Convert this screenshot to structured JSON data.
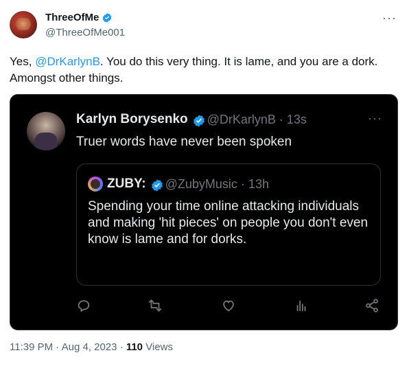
{
  "author": {
    "display_name": "ThreeOfMe",
    "handle": "@ThreeOfMe001"
  },
  "tweet": {
    "text_before": "Yes, ",
    "mention": "@DrKarlynB",
    "text_after": ". You do this very thing. It is lame, and you are a dork. Amongst other things."
  },
  "embedded": {
    "display_name": "Karlyn Borysenko",
    "handle_time": "@DrKarlynB · 13s",
    "text": "Truer words have never been spoken",
    "quoted": {
      "display_name": "ZUBY:",
      "handle_time": "@ZubyMusic · 13h",
      "text": "Spending your time online attacking individuals and making 'hit pieces' on people you don't even know is lame and for dorks."
    },
    "actions": [
      "reply-icon",
      "retweet-icon",
      "like-icon",
      "views-icon",
      "share-icon"
    ]
  },
  "meta": {
    "timestamp": "11:39 PM · Aug 4, 2023 · ",
    "views_count": "110",
    "views_label": " Views"
  },
  "colors": {
    "accent": "#1d9bf0",
    "embed_bg": "#000000",
    "muted": "#536471"
  }
}
